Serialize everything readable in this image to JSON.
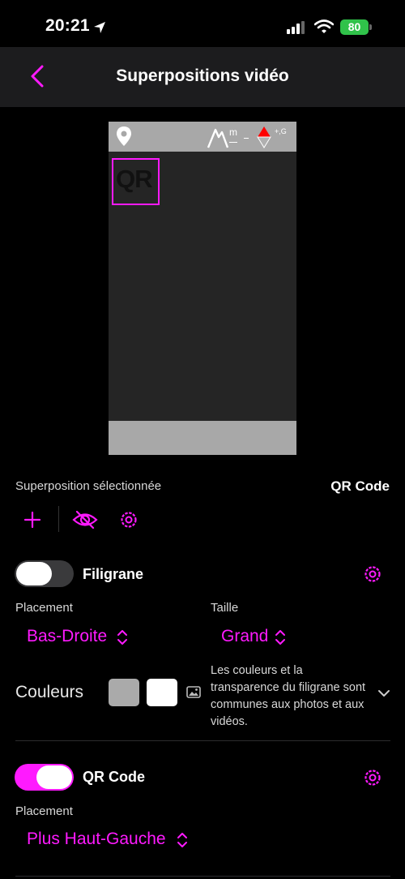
{
  "status": {
    "time": "20:21",
    "battery": "80"
  },
  "nav": {
    "title": "Superpositions vidéo"
  },
  "preview": {
    "qr_label": "QR",
    "altitude_unit": "m",
    "speed_unit": "+,G"
  },
  "selected": {
    "label": "Superposition sélectionnée",
    "value": "QR Code"
  },
  "watermark": {
    "title": "Filigrane",
    "enabled": false,
    "placement_label": "Placement",
    "placement_value": "Bas-Droite",
    "size_label": "Taille",
    "size_value": "Grand",
    "colors_label": "Couleurs",
    "colors": [
      "#aaaaaa",
      "#ffffff"
    ],
    "note": "Les couleurs et la transparence du filigrane sont communes aux photos et aux vidéos."
  },
  "qrcode": {
    "title": "QR Code",
    "enabled": true,
    "placement_label": "Placement",
    "placement_value": "Plus Haut-Gauche"
  },
  "colors": {
    "accent": "#ff1aff",
    "navbar": "#1c1c1e",
    "battery": "#30c24a"
  },
  "icons": [
    "location-arrow-icon",
    "signal-icon",
    "wifi-icon",
    "battery-icon",
    "back-chevron-icon",
    "pin-icon",
    "mountain-icon",
    "compass-icon",
    "plus-icon",
    "eye-slash-icon",
    "gear-icon",
    "updown-chevron-icon",
    "image-icon",
    "chevron-down-icon"
  ]
}
